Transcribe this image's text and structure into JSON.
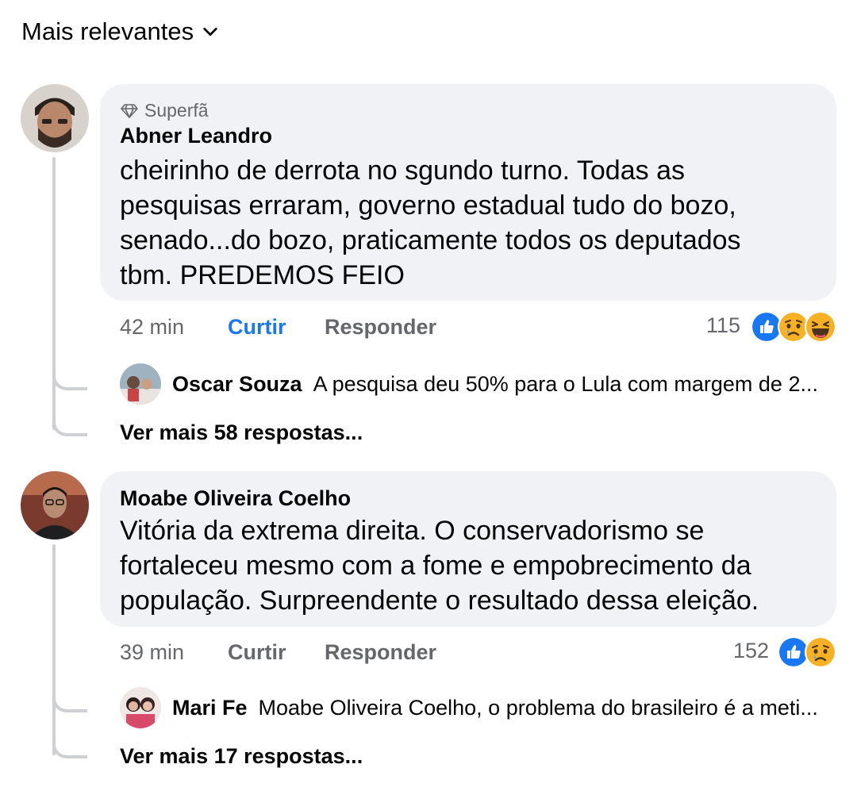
{
  "sort": {
    "label": "Mais relevantes",
    "icon": "chevron-down-icon"
  },
  "comments": [
    {
      "badge": "Superfã",
      "badge_icon": "diamond-icon",
      "author": "Abner Leandro",
      "lines": [
        "cheirinho de derrota no sgundo turno. Todas as",
        "pesquisas erraram, governo estadual tudo do bozo,",
        "senado...do bozo, praticamente todos os deputados",
        "tbm. PREDEMOS FEIO"
      ],
      "time": "42 min",
      "like": "Curtir",
      "like_active": true,
      "reply": "Responder",
      "reaction_count": "115",
      "reactions": [
        "like-icon",
        "sad-icon",
        "haha-icon"
      ],
      "reply_preview": {
        "name": "Oscar Souza",
        "text": "A pesquisa deu 50% para o Lula com margem de 2..."
      },
      "more_replies": "Ver mais 58 respostas..."
    },
    {
      "author": "Moabe Oliveira Coelho",
      "lines": [
        "Vitória da extrema direita. O conservadorismo se",
        "fortaleceu mesmo com a fome e empobrecimento da",
        "população. Surpreendente o resultado dessa eleição."
      ],
      "time": "39 min",
      "like": "Curtir",
      "like_active": false,
      "reply": "Responder",
      "reaction_count": "152",
      "reactions": [
        "like-icon",
        "sad-icon"
      ],
      "reply_preview": {
        "name": "Mari Fe",
        "text": "Moabe Oliveira Coelho, o problema do brasileiro é a meti..."
      },
      "more_replies": "Ver mais 17 respostas..."
    }
  ],
  "colors": {
    "blue": "#1877f2",
    "gray": "#65676b",
    "bubble": "#f0f2f5",
    "line": "#ced0d4"
  }
}
